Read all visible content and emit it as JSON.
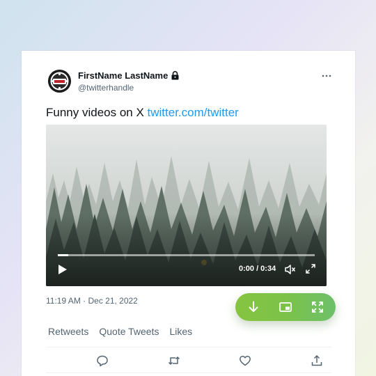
{
  "tweet": {
    "author_name": "FirstName LastName",
    "handle": "@twitterhandle",
    "text_plain": "Funny videos on X ",
    "text_link": "twitter.com/twitter",
    "timestamp": "11:19 AM · Dec 21, 2022"
  },
  "video": {
    "time_display": "0:00 / 0:34",
    "progress": 0.04
  },
  "stats": [
    {
      "label": "Retweets"
    },
    {
      "label": "Quote Tweets"
    },
    {
      "label": "Likes"
    }
  ],
  "icons": {
    "avatar": "wsop-logo",
    "protected": "lock-icon",
    "more": "more-horizontal-icon",
    "play": "play-icon",
    "mute": "volume-mute-icon",
    "fullscreen": "fullscreen-icon",
    "reply": "reply-icon",
    "retweet": "retweet-icon",
    "like": "heart-icon",
    "share": "share-icon",
    "download": "download-icon",
    "pip": "picture-in-picture-icon",
    "expand": "expand-icon"
  },
  "colors": {
    "link": "#1d9bf0",
    "text": "#0f1419",
    "muted": "#536471",
    "toolbar_start": "#86c440",
    "toolbar_end": "#6dc06a"
  }
}
